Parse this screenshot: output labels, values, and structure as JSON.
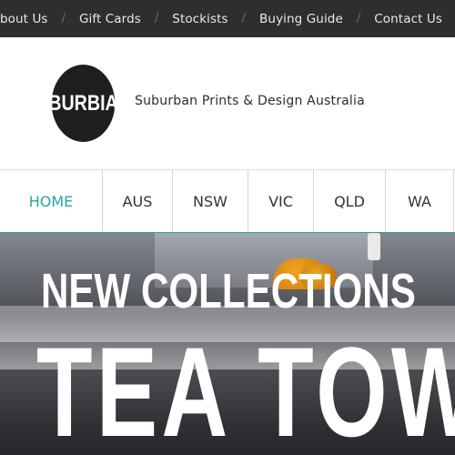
{
  "topbar": {
    "links": [
      "About Us",
      "Gift Cards",
      "Stockists",
      "Buying Guide",
      "Contact Us"
    ],
    "separator": "/"
  },
  "header": {
    "logo_text": "BURBIA",
    "tagline": "Suburban Prints & Design Australia"
  },
  "nav": {
    "items": [
      "HOME",
      "AUS",
      "NSW",
      "VIC",
      "QLD",
      "WA"
    ],
    "active": "HOME"
  },
  "hero": {
    "headline": "NEW COLLECTIONS",
    "title": "TEA TOWEL"
  },
  "colors": {
    "topbar_bg": "#2e2e2c",
    "accent": "#2aa39b",
    "logo_bg": "#1f1f1f"
  }
}
